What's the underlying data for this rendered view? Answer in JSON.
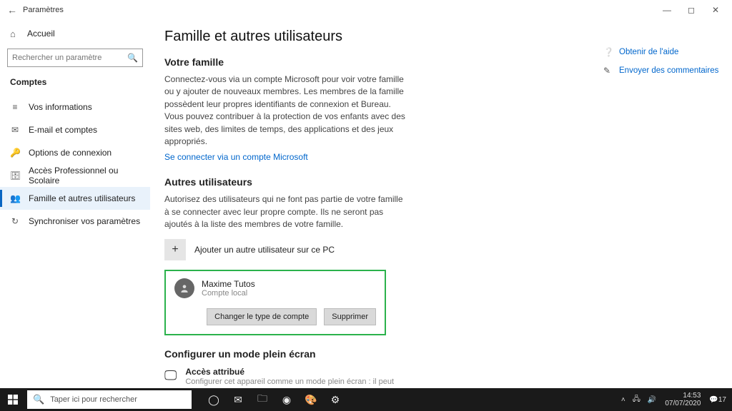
{
  "titlebar": {
    "title": "Paramètres"
  },
  "sidebar": {
    "home": "Accueil",
    "search_placeholder": "Rechercher un paramètre",
    "category": "Comptes",
    "items": [
      {
        "label": "Vos informations"
      },
      {
        "label": "E-mail et comptes"
      },
      {
        "label": "Options de connexion"
      },
      {
        "label": "Accès Professionnel ou Scolaire"
      },
      {
        "label": "Famille et autres utilisateurs"
      },
      {
        "label": "Synchroniser vos paramètres"
      }
    ]
  },
  "main": {
    "heading": "Famille et autres utilisateurs",
    "family": {
      "title": "Votre famille",
      "desc": "Connectez-vous via un compte Microsoft pour voir votre famille ou y ajouter de nouveaux membres. Les membres de la famille possèdent leur propres identifiants de connexion et Bureau. Vous pouvez contribuer à la protection de vos enfants avec des sites web, des limites de temps, des applications et des jeux appropriés.",
      "link": "Se connecter via un compte Microsoft"
    },
    "others": {
      "title": "Autres utilisateurs",
      "desc": "Autorisez des utilisateurs qui ne font pas partie de votre famille à se connecter avec leur propre compte. Ils ne seront pas ajoutés à la liste des membres de votre famille.",
      "add_label": "Ajouter un autre utilisateur sur ce PC",
      "user": {
        "name": "Maxime Tutos",
        "type": "Compte local",
        "change_btn": "Changer le type de compte",
        "delete_btn": "Supprimer"
      }
    },
    "kiosk": {
      "title": "Configurer un mode plein écran",
      "heading": "Accès attribué",
      "desc": "Configurer cet appareil comme un mode plein écran : il peut s'agir d'un signe numérique, d'un affichage interactif ou d'un navigateur public, entre autres choses."
    }
  },
  "rail": {
    "help": "Obtenir de l'aide",
    "feedback": "Envoyer des commentaires"
  },
  "taskbar": {
    "search_placeholder": "Taper ici pour rechercher",
    "tray": {
      "time": "14:53",
      "date": "07/07/2020",
      "notif": "17"
    }
  }
}
